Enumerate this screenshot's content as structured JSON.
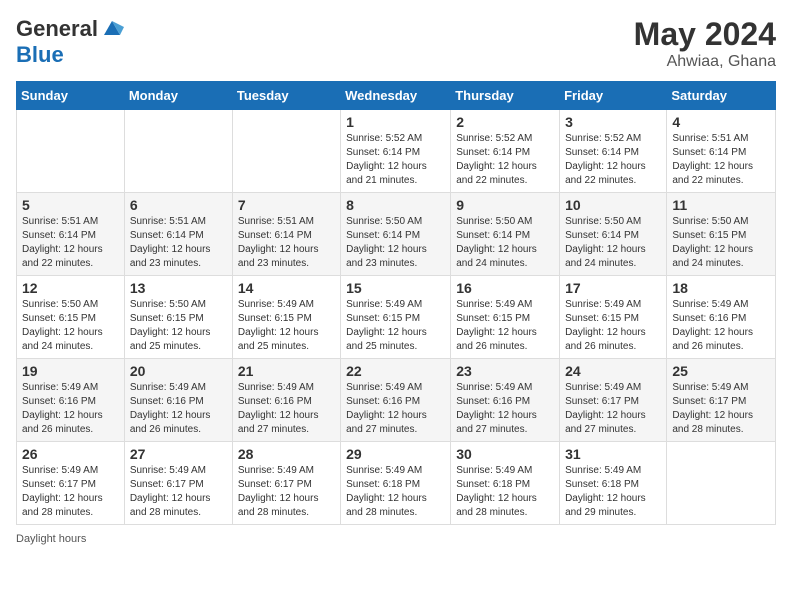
{
  "header": {
    "logo_general": "General",
    "logo_blue": "Blue",
    "month_title": "May 2024",
    "location": "Ahwiaa, Ghana"
  },
  "weekdays": [
    "Sunday",
    "Monday",
    "Tuesday",
    "Wednesday",
    "Thursday",
    "Friday",
    "Saturday"
  ],
  "footer": {
    "daylight_hours_label": "Daylight hours"
  },
  "weeks": [
    [
      {
        "day": "",
        "info": ""
      },
      {
        "day": "",
        "info": ""
      },
      {
        "day": "",
        "info": ""
      },
      {
        "day": "1",
        "info": "Sunrise: 5:52 AM\nSunset: 6:14 PM\nDaylight: 12 hours\nand 21 minutes."
      },
      {
        "day": "2",
        "info": "Sunrise: 5:52 AM\nSunset: 6:14 PM\nDaylight: 12 hours\nand 22 minutes."
      },
      {
        "day": "3",
        "info": "Sunrise: 5:52 AM\nSunset: 6:14 PM\nDaylight: 12 hours\nand 22 minutes."
      },
      {
        "day": "4",
        "info": "Sunrise: 5:51 AM\nSunset: 6:14 PM\nDaylight: 12 hours\nand 22 minutes."
      }
    ],
    [
      {
        "day": "5",
        "info": "Sunrise: 5:51 AM\nSunset: 6:14 PM\nDaylight: 12 hours\nand 22 minutes."
      },
      {
        "day": "6",
        "info": "Sunrise: 5:51 AM\nSunset: 6:14 PM\nDaylight: 12 hours\nand 23 minutes."
      },
      {
        "day": "7",
        "info": "Sunrise: 5:51 AM\nSunset: 6:14 PM\nDaylight: 12 hours\nand 23 minutes."
      },
      {
        "day": "8",
        "info": "Sunrise: 5:50 AM\nSunset: 6:14 PM\nDaylight: 12 hours\nand 23 minutes."
      },
      {
        "day": "9",
        "info": "Sunrise: 5:50 AM\nSunset: 6:14 PM\nDaylight: 12 hours\nand 24 minutes."
      },
      {
        "day": "10",
        "info": "Sunrise: 5:50 AM\nSunset: 6:14 PM\nDaylight: 12 hours\nand 24 minutes."
      },
      {
        "day": "11",
        "info": "Sunrise: 5:50 AM\nSunset: 6:15 PM\nDaylight: 12 hours\nand 24 minutes."
      }
    ],
    [
      {
        "day": "12",
        "info": "Sunrise: 5:50 AM\nSunset: 6:15 PM\nDaylight: 12 hours\nand 24 minutes."
      },
      {
        "day": "13",
        "info": "Sunrise: 5:50 AM\nSunset: 6:15 PM\nDaylight: 12 hours\nand 25 minutes."
      },
      {
        "day": "14",
        "info": "Sunrise: 5:49 AM\nSunset: 6:15 PM\nDaylight: 12 hours\nand 25 minutes."
      },
      {
        "day": "15",
        "info": "Sunrise: 5:49 AM\nSunset: 6:15 PM\nDaylight: 12 hours\nand 25 minutes."
      },
      {
        "day": "16",
        "info": "Sunrise: 5:49 AM\nSunset: 6:15 PM\nDaylight: 12 hours\nand 26 minutes."
      },
      {
        "day": "17",
        "info": "Sunrise: 5:49 AM\nSunset: 6:15 PM\nDaylight: 12 hours\nand 26 minutes."
      },
      {
        "day": "18",
        "info": "Sunrise: 5:49 AM\nSunset: 6:16 PM\nDaylight: 12 hours\nand 26 minutes."
      }
    ],
    [
      {
        "day": "19",
        "info": "Sunrise: 5:49 AM\nSunset: 6:16 PM\nDaylight: 12 hours\nand 26 minutes."
      },
      {
        "day": "20",
        "info": "Sunrise: 5:49 AM\nSunset: 6:16 PM\nDaylight: 12 hours\nand 26 minutes."
      },
      {
        "day": "21",
        "info": "Sunrise: 5:49 AM\nSunset: 6:16 PM\nDaylight: 12 hours\nand 27 minutes."
      },
      {
        "day": "22",
        "info": "Sunrise: 5:49 AM\nSunset: 6:16 PM\nDaylight: 12 hours\nand 27 minutes."
      },
      {
        "day": "23",
        "info": "Sunrise: 5:49 AM\nSunset: 6:16 PM\nDaylight: 12 hours\nand 27 minutes."
      },
      {
        "day": "24",
        "info": "Sunrise: 5:49 AM\nSunset: 6:17 PM\nDaylight: 12 hours\nand 27 minutes."
      },
      {
        "day": "25",
        "info": "Sunrise: 5:49 AM\nSunset: 6:17 PM\nDaylight: 12 hours\nand 28 minutes."
      }
    ],
    [
      {
        "day": "26",
        "info": "Sunrise: 5:49 AM\nSunset: 6:17 PM\nDaylight: 12 hours\nand 28 minutes."
      },
      {
        "day": "27",
        "info": "Sunrise: 5:49 AM\nSunset: 6:17 PM\nDaylight: 12 hours\nand 28 minutes."
      },
      {
        "day": "28",
        "info": "Sunrise: 5:49 AM\nSunset: 6:17 PM\nDaylight: 12 hours\nand 28 minutes."
      },
      {
        "day": "29",
        "info": "Sunrise: 5:49 AM\nSunset: 6:18 PM\nDaylight: 12 hours\nand 28 minutes."
      },
      {
        "day": "30",
        "info": "Sunrise: 5:49 AM\nSunset: 6:18 PM\nDaylight: 12 hours\nand 28 minutes."
      },
      {
        "day": "31",
        "info": "Sunrise: 5:49 AM\nSunset: 6:18 PM\nDaylight: 12 hours\nand 29 minutes."
      },
      {
        "day": "",
        "info": ""
      }
    ]
  ]
}
